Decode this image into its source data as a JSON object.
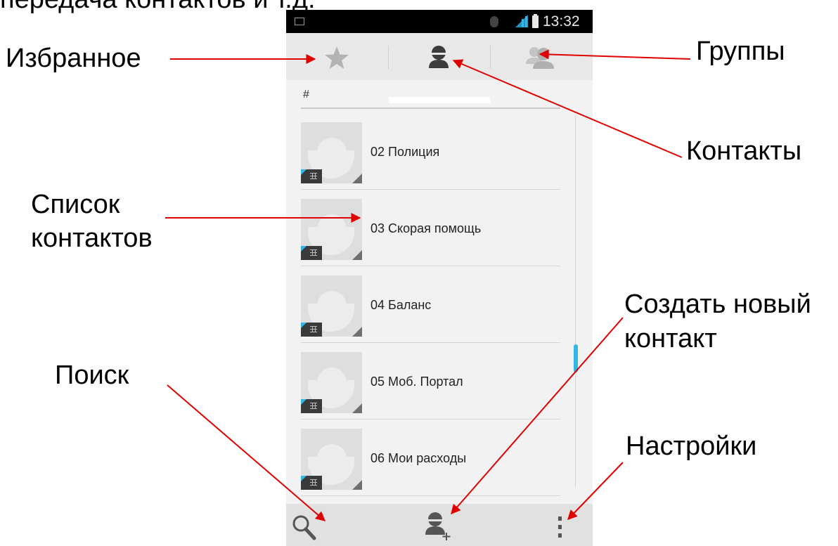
{
  "caption": {
    "top_text": "передача контактов и т.д."
  },
  "statusbar": {
    "time": "13:32"
  },
  "tabs": [
    {
      "id": "favorites",
      "icon": "star-icon"
    },
    {
      "id": "contacts",
      "icon": "person-icon",
      "selected": true
    },
    {
      "id": "groups",
      "icon": "group-icon"
    }
  ],
  "list": {
    "section_header": "#",
    "contacts": [
      {
        "name": "02 Полиция"
      },
      {
        "name": "03 Скорая помощь"
      },
      {
        "name": "04 Баланс"
      },
      {
        "name": "05 Моб. Портал"
      },
      {
        "name": "06 Мои расходы"
      }
    ]
  },
  "bottombar": {
    "actions": [
      {
        "id": "search",
        "icon": "search-icon"
      },
      {
        "id": "add-contact",
        "icon": "add-contact-icon"
      },
      {
        "id": "menu",
        "icon": "overflow-menu-icon"
      }
    ]
  },
  "annotations": {
    "favorites": "Избранное",
    "groups": "Группы",
    "contacts": "Контакты",
    "contact_list_line1": "Список",
    "contact_list_line2": "контактов",
    "create_line1": "Создать новый",
    "create_line2": "контакт",
    "search": "Поиск",
    "settings": "Настройки",
    "arrow_color": "#e00000"
  },
  "colors": {
    "accent": "#33b5e5",
    "statusbar": "#000000",
    "background": "#f2f2f2"
  }
}
